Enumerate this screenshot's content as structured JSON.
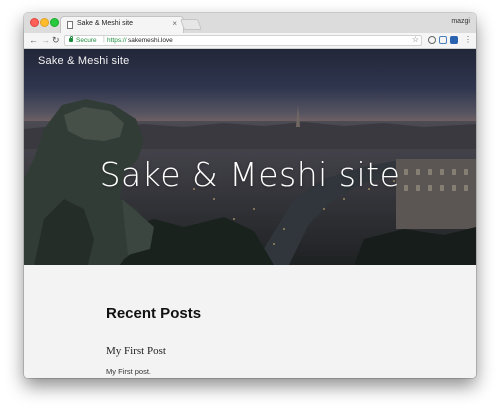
{
  "browser": {
    "tab": {
      "title": "Sake & Meshi site",
      "close": "×"
    },
    "profile_name": "mazgi",
    "address_bar": {
      "secure_label": "Secure",
      "separator": "|",
      "scheme": "https://",
      "host": "sakemeshi.love"
    },
    "icons": [
      "back-icon",
      "forward-icon",
      "reload-icon",
      "lock-icon",
      "star-icon",
      "info-icon",
      "extension-icon",
      "menu-icon"
    ]
  },
  "site": {
    "header_name": "Sake & Meshi site",
    "hero_title": "Sake & Meshi site"
  },
  "content": {
    "recent_posts_heading": "Recent Posts",
    "posts": [
      {
        "title": "My First Post",
        "excerpt": "My First post."
      }
    ]
  }
}
